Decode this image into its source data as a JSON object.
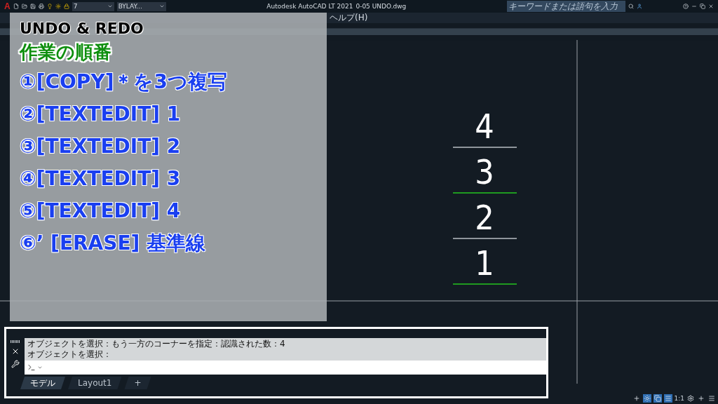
{
  "title_bar": {
    "logo": "A",
    "layer": "7",
    "linetype": "BYLAY...",
    "app": "Autodesk AutoCAD LT 2021",
    "file": "0-05 UNDO.dwg",
    "search": {
      "placeholder": "キーワードまたは語句を入力"
    }
  },
  "menu": [
    "ヘルプ(H)"
  ],
  "drawing": {
    "items": [
      {
        "text": "4",
        "color": "#8f959b"
      },
      {
        "text": "3",
        "color": "#1f9a1f"
      },
      {
        "text": "2",
        "color": "#8f959b"
      },
      {
        "text": "1",
        "color": "#1f9a1f"
      }
    ]
  },
  "overlay": {
    "title": "UNDO & REDO",
    "subtitle": "作業の順番",
    "steps": [
      "①[COPY]＊を3つ複写",
      "②[TEXTEDIT] 1",
      "③[TEXTEDIT] 2",
      "④[TEXTEDIT] 3",
      "⑤[TEXTEDIT] 4",
      "⑥’ [ERASE] 基準線"
    ]
  },
  "command_line": {
    "history": [
      "オブジェクトを選択：もう一方のコーナーを指定：認識された数：4",
      "オブジェクトを選択："
    ]
  },
  "layout_tabs": [
    {
      "label": "モデル",
      "selected": true
    },
    {
      "label": "Layout1",
      "selected": false
    },
    {
      "label": "+",
      "selected": false
    }
  ],
  "status_bar": {
    "scale": "1:1"
  }
}
